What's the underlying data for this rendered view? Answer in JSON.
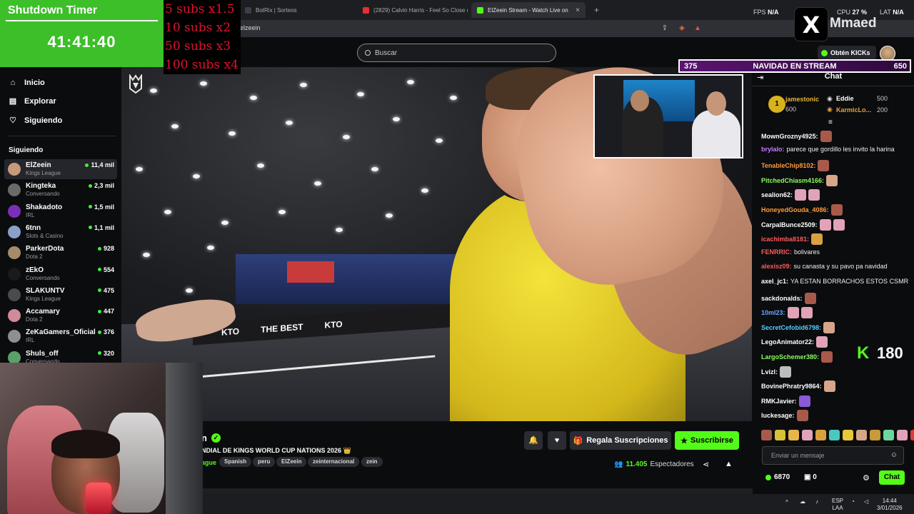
{
  "browser": {
    "tabs": [
      {
        "title": "BotRix | Sorteos",
        "color": "#3b3f49"
      },
      {
        "title": "(2829) Calvin Harris - Feel So Close (",
        "color": "#e8312f"
      },
      {
        "title": "ElZeein Stream - Watch Live on",
        "color": "#53fc18"
      }
    ],
    "new_tab": "+",
    "url": "elzeein"
  },
  "overlay": {
    "timer_title": "Shutdown Timer",
    "timer_value": "41:41:40",
    "subs_rules": [
      "5 subs x1.5",
      "10 subs x2",
      "50 subs x3",
      "100 subs x4"
    ],
    "brand": "Mmaed",
    "x_logo": "X",
    "stats": [
      {
        "label": "FPS",
        "value": "N/A"
      },
      {
        "label": "CPU",
        "value": "27 %"
      },
      {
        "label": "LAT",
        "value": "N/A"
      }
    ]
  },
  "topnav": {
    "search_placeholder": "Buscar",
    "get_kicks": "Obtén KICKs"
  },
  "sidebar": {
    "nav": [
      {
        "label": "Inicio",
        "icon": "home-icon",
        "glyph": "⌂"
      },
      {
        "label": "Explorar",
        "icon": "browse-icon",
        "glyph": "▤"
      },
      {
        "label": "Siguiendo",
        "icon": "heart-icon",
        "glyph": "♡"
      }
    ],
    "following_header": "Siguiendo",
    "channels": [
      {
        "name": "ElZeein",
        "category": "Kings League",
        "viewers": "11,4 mil",
        "avatar": "#c79a7a"
      },
      {
        "name": "Kingteka",
        "category": "Conversando",
        "viewers": "2,3 mil",
        "avatar": "#6a6a6a"
      },
      {
        "name": "Shakadoto",
        "category": "IRL",
        "viewers": "1,5 mil",
        "avatar": "#7b2fb8"
      },
      {
        "name": "6tnn",
        "category": "Slots & Casino",
        "viewers": "1,1 mil",
        "avatar": "#8aa0c8"
      },
      {
        "name": "ParkerDota",
        "category": "Dota 2",
        "viewers": "928",
        "avatar": "#a58a6c"
      },
      {
        "name": "zEkO",
        "category": "Conversando",
        "viewers": "554",
        "avatar": "#1a1a1a"
      },
      {
        "name": "SLAKUNTV",
        "category": "Kings League",
        "viewers": "475",
        "avatar": "#4b4b4b"
      },
      {
        "name": "Accamary",
        "category": "Dota 2",
        "viewers": "447",
        "avatar": "#d18a9a"
      },
      {
        "name": "ZeKaGamers_Oficial",
        "category": "IRL",
        "viewers": "376",
        "avatar": "#8f8f8f"
      },
      {
        "name": "Shuls_off",
        "category": "Conversando",
        "viewers": "320",
        "avatar": "#5aa06a"
      }
    ]
  },
  "stream": {
    "title_tail": "n",
    "subtitle": "NDIAL DE KINGS WORLD CUP NATIONS 2026 👑",
    "category": "ague",
    "tags": [
      "Spanish",
      "peru",
      "ElZeein",
      "zeinternacional",
      "zein"
    ],
    "gift_label": "Regala Suscripciones",
    "subscribe_label": "Suscribirse",
    "viewers": "11.405",
    "viewers_label": "Espectadores",
    "ad_texts": [
      "KTO",
      "THE BEST",
      "KTO"
    ]
  },
  "goal": {
    "left": "375",
    "title": "NAVIDAD EN STREAM",
    "right": "650"
  },
  "chat": {
    "header": "Chat",
    "leaderboard": [
      {
        "rank": "1",
        "name": "jamestonic",
        "value": "600",
        "color": "#e7b53a"
      },
      {
        "name": "Eddie",
        "value": "500",
        "color": "#ffffff"
      },
      {
        "name": "KarmicLo...",
        "value": "200",
        "color": "#e8a23c"
      }
    ],
    "messages": [
      {
        "user": "MownGrozny4925:",
        "color": "#ffffff",
        "text": "",
        "emotes": [
          "#a85a4a"
        ]
      },
      {
        "user": "brylalo:",
        "color": "#c67cff",
        "text": "parece que gordillo les invito la harina",
        "emotes": []
      },
      {
        "user": "TenableChip8102:",
        "color": "#ff9a3c",
        "text": "",
        "emotes": [
          "#a85a4a"
        ]
      },
      {
        "user": "PitchedChiasm4166:",
        "color": "#8cff5a",
        "text": "",
        "emotes": [
          "#d7a58a"
        ]
      },
      {
        "user": "sealion62:",
        "color": "#ffffff",
        "text": "",
        "emotes": [
          "#e2a3b8",
          "#e2a3b8"
        ]
      },
      {
        "user": "HoneyedGouda_4086:",
        "color": "#ff9a3c",
        "text": "",
        "emotes": [
          "#a85a4a"
        ]
      },
      {
        "user": "CarpalBunce2509:",
        "color": "#ffffff",
        "text": "",
        "emotes": [
          "#e2a3b8",
          "#e2a3b8"
        ]
      },
      {
        "user": "icachimba8181:",
        "color": "#ff5a5a",
        "text": "",
        "emotes": [
          "#d7a040"
        ]
      },
      {
        "user": "FENRRIC:",
        "color": "#ff5a5a",
        "text": "bolivares",
        "emotes": []
      },
      {
        "user": "alexisz09:",
        "color": "#ff5a5a",
        "text": "su canasta y su pavo pa navidad",
        "emotes": []
      },
      {
        "user": "axel_jc1:",
        "color": "#ffffff",
        "text": "YA ESTAN BORRACHOS ESTOS CSMR",
        "emotes": []
      },
      {
        "user": "sackdonalds:",
        "color": "#ffffff",
        "text": "",
        "emotes": [
          "#a85a4a"
        ]
      },
      {
        "user": "10ml23:",
        "color": "#6aa8ff",
        "text": "",
        "emotes": [
          "#e2a3b8",
          "#e2a3b8"
        ]
      },
      {
        "user": "SecretCefobid6798:",
        "color": "#5acbff",
        "text": "",
        "emotes": [
          "#d7a58a"
        ]
      },
      {
        "user": "LegoAnimator22:",
        "color": "#ffffff",
        "text": "",
        "emotes": [
          "#e2a3b8"
        ]
      },
      {
        "user": "LargoSchemer380:",
        "color": "#8cff5a",
        "text": "",
        "emotes": [
          "#a85a4a"
        ]
      },
      {
        "user": "Lvizl:",
        "color": "#ffffff",
        "text": "",
        "emotes": [
          "#bdbdbd"
        ]
      },
      {
        "user": "BovinePhratry9864:",
        "color": "#ffffff",
        "text": "",
        "emotes": [
          "#d7a58a"
        ]
      },
      {
        "user": "RMKJavier:",
        "color": "#ffffff",
        "text": "",
        "emotes": [
          "#8a5ad7"
        ]
      },
      {
        "user": "luckesage:",
        "color": "#ffffff",
        "text": "",
        "emotes": [
          "#a85a4a"
        ]
      }
    ],
    "kicks_total": "180",
    "input_placeholder": "Enviar un mensaje",
    "points": "6870",
    "gifts": "0",
    "send_label": "Chat",
    "emote_palette": [
      "#a85a4a",
      "#d7c03a",
      "#e8b54a",
      "#e2a3b8",
      "#d7a040",
      "#4ac8c0",
      "#e8c83a",
      "#d7a58a",
      "#c79a3a",
      "#6ad7a0",
      "#e2a3b8",
      "#e23a3a"
    ]
  },
  "taskbar": {
    "lang": "ESP",
    "lang2": "LAA",
    "time": "14:44",
    "date": "3/01/2026"
  }
}
